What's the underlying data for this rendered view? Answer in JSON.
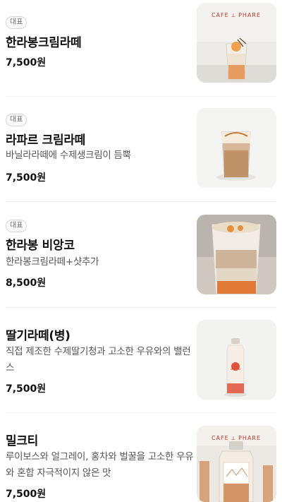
{
  "items": [
    {
      "badge": "대표",
      "name": "한라봉크림라떼",
      "description": "",
      "price": "7,500원",
      "image": {
        "icon": "iced-latte-with-orange-garnish-photo",
        "logo_text": "CAFE ⟂ PHARE"
      }
    },
    {
      "badge": "대표",
      "name": "라파르 크림라떼",
      "description": "바닐라라떼에 수제생크림이 듬뿍",
      "price": "7,500원",
      "image": {
        "icon": "cream-latte-glass-photo"
      }
    },
    {
      "badge": "대표",
      "name": "한라봉 비앙코",
      "description": "한라봉크림라떼+샷추가",
      "price": "8,500원",
      "image": {
        "icon": "layered-orange-milk-drink-photo"
      }
    },
    {
      "badge": "",
      "name": "딸기라떼(병)",
      "description": "직접 제조한 수제딸기청과 고소한 우유와의 밸런스",
      "price": "7,500원",
      "image": {
        "icon": "strawberry-latte-bottle-photo"
      }
    },
    {
      "badge": "",
      "name": "밀크티",
      "description": "루이보스와 얼그레이, 홍차와 벌꿀을 고소한 우유와 혼합 자극적이지 않은 맛",
      "price": "7,500원",
      "image": {
        "icon": "milk-tea-bottles-photo",
        "logo_text": "CAFE ⟂ PHARE"
      }
    }
  ]
}
